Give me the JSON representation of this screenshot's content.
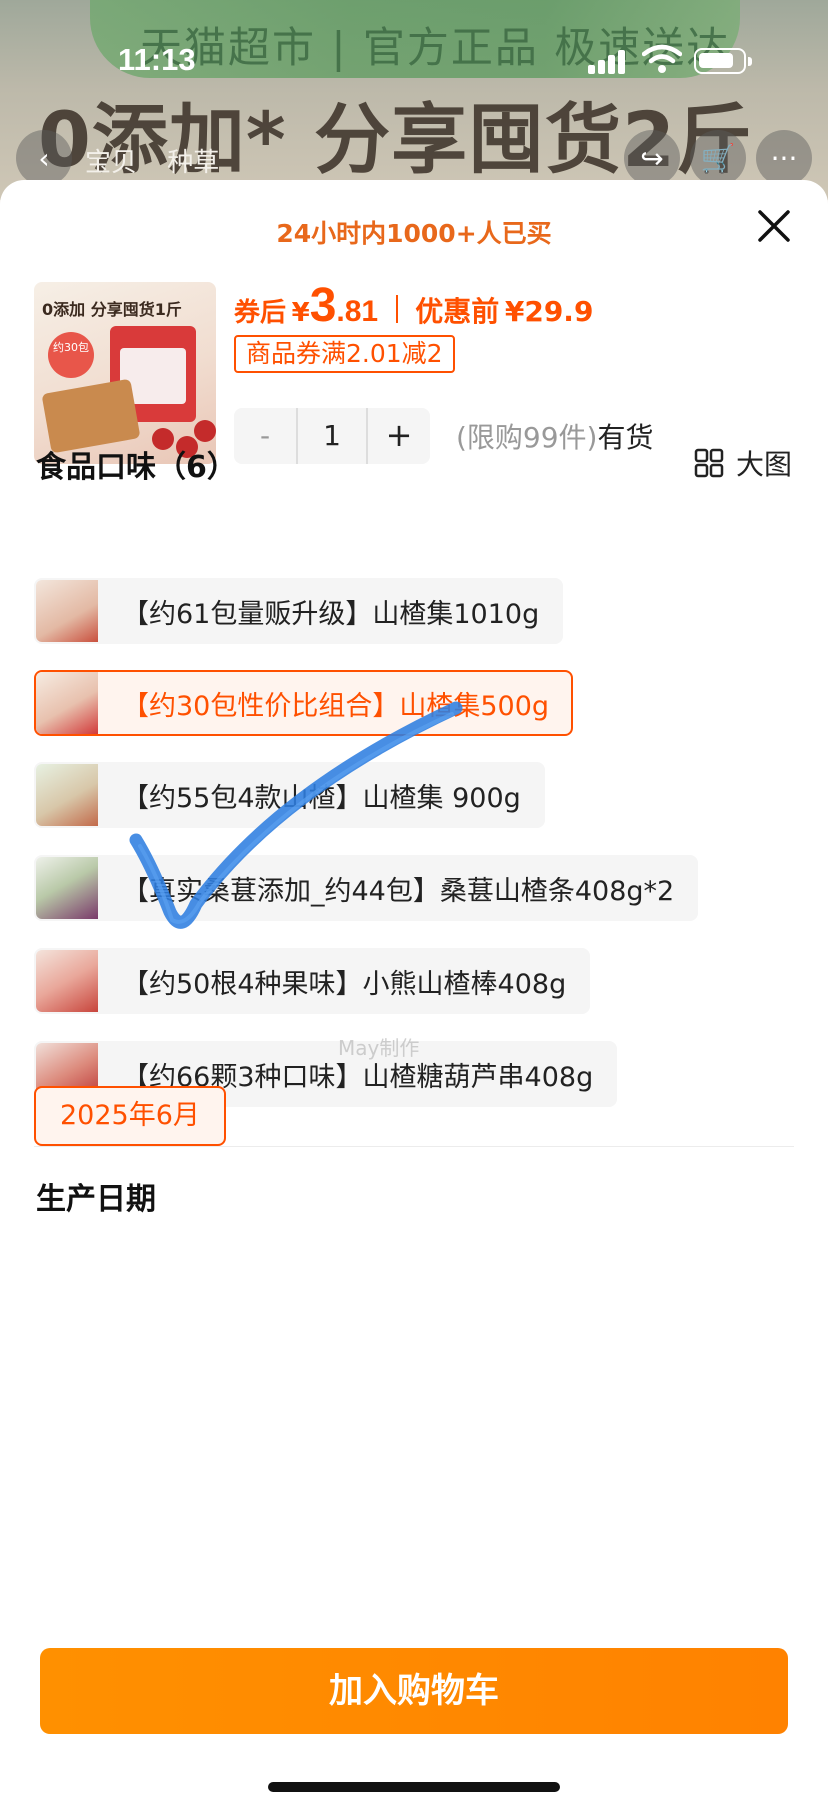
{
  "status_bar": {
    "time": "11:13"
  },
  "background": {
    "banner_top": "天猫超市 | 官方正品 极速送达",
    "banner_main": "0添加* 分享囤货2斤",
    "tabs": [
      "宝贝",
      "种草"
    ]
  },
  "sheet": {
    "social_proof": "24小时内1000+人已买",
    "product": {
      "thumb_text": "0添加 分享囤货1斤",
      "thumb_badge": "约30包",
      "price_label": "券后",
      "currency": "¥",
      "price_int": "3",
      "price_dec": ".81",
      "original_label": "优惠前",
      "original_price": "¥29.9",
      "coupon": "商品券满2.01减2"
    },
    "quantity": {
      "minus": "-",
      "value": "1",
      "plus": "+"
    },
    "stock": {
      "limit": "(限购99件)",
      "availability": "有货"
    },
    "flavor_section": {
      "title": "食品口味（6）",
      "big_view_label": "大图",
      "options": [
        {
          "label": "【约61包量贩升级】山楂集1010g",
          "selected": false
        },
        {
          "label": "【约30包性价比组合】山楂集500g",
          "selected": true
        },
        {
          "label": "【约55包4款山楂】山楂集 900g",
          "selected": false
        },
        {
          "label": "【真实桑葚添加_约44包】桑葚山楂条408g*2",
          "selected": false
        },
        {
          "label": "【约50根4种果味】小熊山楂棒408g",
          "selected": false
        },
        {
          "label": "【约66颗3种口味】山楂糖葫芦串408g",
          "selected": false
        }
      ]
    },
    "date_section": {
      "title": "生产日期",
      "option": "2025年6月"
    },
    "cta": {
      "add_to_cart": "加入购物车"
    },
    "watermark": "May制作"
  },
  "colors": {
    "accent": "#ff5000",
    "cta": "#ff8a00",
    "checkmark": "#2f7ee0"
  }
}
